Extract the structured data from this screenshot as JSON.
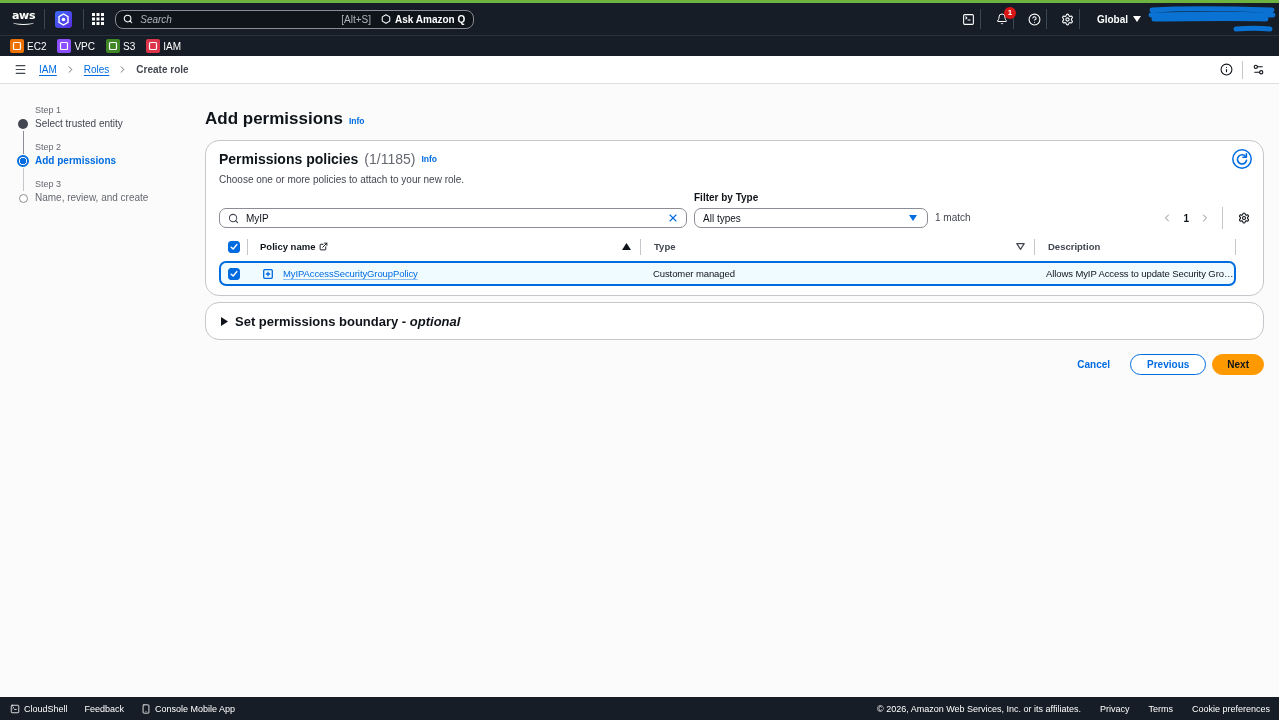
{
  "top_nav": {
    "logo_text": "aws",
    "search": {
      "placeholder": "Search",
      "shortcut": "[Alt+S]"
    },
    "ask_button": "Ask Amazon Q",
    "notification_count": "1",
    "region": "Global"
  },
  "favorites": [
    {
      "label": "EC2",
      "color": "#ed7100"
    },
    {
      "label": "VPC",
      "color": "#8c4fff"
    },
    {
      "label": "S3",
      "color": "#3f8624"
    },
    {
      "label": "IAM",
      "color": "#dd344c"
    }
  ],
  "breadcrumbs": [
    {
      "label": "IAM",
      "kind": "link"
    },
    {
      "label": "Roles",
      "kind": "link"
    },
    {
      "label": "Create role",
      "kind": "current"
    }
  ],
  "steps": [
    {
      "step": "Step 1",
      "label": "Select trusted entity",
      "completed": true,
      "selected": false
    },
    {
      "step": "Step 2",
      "label": "Add permissions",
      "completed": false,
      "selected": true
    },
    {
      "step": "Step 3",
      "label": "Name, review, and create",
      "completed": false,
      "selected": false
    }
  ],
  "page": {
    "title": "Add permissions",
    "info_link": "Info"
  },
  "policies_panel": {
    "title": "Permissions policies",
    "count": "(1/1185)",
    "info_link": "Info",
    "description": "Choose one or more policies to attach to your new role.",
    "search": {
      "value": "MyIP"
    },
    "filter": {
      "label": "Filter by Type",
      "value": "All types"
    },
    "match_count": "1 match",
    "pagination": {
      "current_page": "1"
    },
    "table": {
      "all_checked": true,
      "columns": [
        {
          "label": "Policy name",
          "sortable": true,
          "sorted": true,
          "external_link": true
        },
        {
          "label": "Type",
          "sortable": true,
          "sorted": false,
          "external_link": false
        },
        {
          "label": "Description",
          "sortable": false,
          "sorted": false,
          "external_link": false
        }
      ],
      "rows": [
        {
          "policy_name": "MyIPAccessSecurityGroupPolicy",
          "type": "Customer managed",
          "description": "Allows MyIP Access to update Security Gro…",
          "checked": true,
          "selected": true,
          "expanded": false
        }
      ]
    }
  },
  "boundary_panel": {
    "title": "Set permissions boundary - *optional*",
    "expanded": false
  },
  "actions": [
    {
      "label": "Cancel",
      "kind": "link"
    },
    {
      "label": "Previous",
      "kind": "secondary"
    },
    {
      "label": "Next",
      "kind": "primary"
    }
  ],
  "footer": {
    "left": [
      {
        "label": "CloudShell",
        "kind": "terminal"
      },
      {
        "label": "Feedback",
        "kind": "plain"
      },
      {
        "label": "Console Mobile App",
        "kind": "mobile"
      }
    ],
    "copyright": "© 2026, Amazon Web Services, Inc. or its affiliates.",
    "links": [
      "Privacy",
      "Terms",
      "Cookie preferences"
    ]
  }
}
